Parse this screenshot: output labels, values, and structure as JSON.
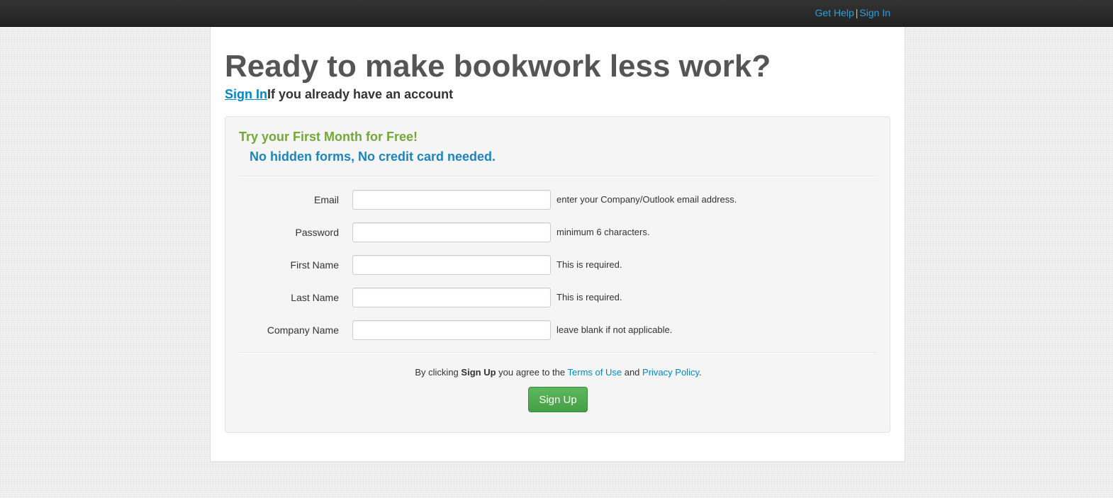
{
  "nav": {
    "help_label": "Get Help",
    "separator": "|",
    "signin_label": "Sign In"
  },
  "page": {
    "title": "Ready to make bookwork less work?",
    "signin_link": "Sign In",
    "signin_suffix": "If you already have an account"
  },
  "promo": {
    "line1": "Try your First Month for Free!",
    "line2": "No hidden forms, No credit card needed."
  },
  "form": {
    "fields": [
      {
        "label": "Email",
        "value": "",
        "help": "enter your Company/Outlook email address."
      },
      {
        "label": "Password",
        "value": "",
        "help": "minimum 6 characters."
      },
      {
        "label": "First Name",
        "value": "",
        "help": "This is required."
      },
      {
        "label": "Last Name",
        "value": "",
        "help": "This is required."
      },
      {
        "label": "Company Name",
        "value": "",
        "help": "leave blank if not applicable."
      }
    ],
    "agree_prefix": "By clicking",
    "agree_bold": "Sign Up",
    "agree_middle": "you agree to the",
    "terms_link": "Terms of Use",
    "agree_and": "and",
    "privacy_link": "Privacy Policy",
    "agree_end": ".",
    "submit_label": "Sign Up"
  },
  "colors": {
    "link": "#0088cc",
    "promo_green": "#73a839",
    "promo_blue": "#1d84bd",
    "button_green": "#5cb85c",
    "topbar": "#2a2a2a"
  }
}
